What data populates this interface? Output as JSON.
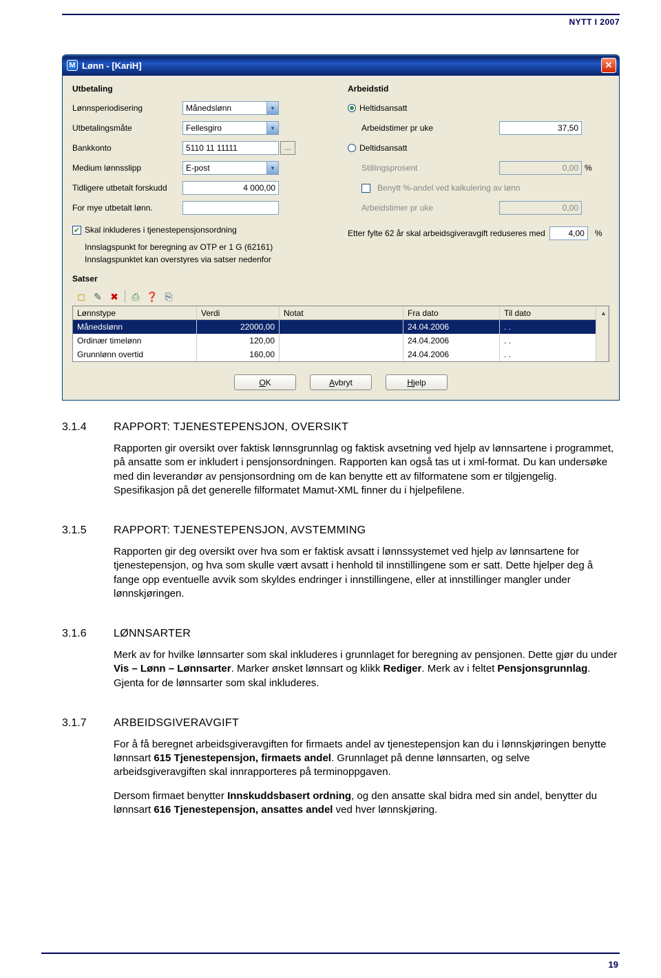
{
  "header": {
    "right": "NYTT I 2007"
  },
  "app": {
    "title": "Lønn - [KariH]",
    "app_icon_letter": "M",
    "close_icon": "✕",
    "groups": {
      "utbetaling": {
        "title": "Utbetaling",
        "rows": {
          "periodisering": {
            "label": "Lønnsperiodisering",
            "value": "Månedslønn"
          },
          "utbetalingsmate": {
            "label": "Utbetalingsmåte",
            "value": "Fellesgiro"
          },
          "bankkonto": {
            "label": "Bankkonto",
            "value": "5110 11 11111"
          },
          "medium": {
            "label": "Medium lønnsslipp",
            "value": "E-post"
          },
          "tidligere": {
            "label": "Tidligere utbetalt forskudd",
            "value": "4 000,00"
          },
          "formye": {
            "label": "For mye utbetalt lønn.",
            "value": ""
          }
        },
        "pension_check": {
          "checked": true,
          "label": "Skal inkluderes i tjenestepensjonsordning"
        },
        "otp_line": "Innslagspunkt for beregning av OTP er 1 G (62161)",
        "overstyr_line": "Innslagspunktet kan overstyres via satser nedenfor"
      },
      "arbeidstid": {
        "title": "Arbeidstid",
        "heltid": {
          "label": "Heltidsansatt",
          "checked": true
        },
        "deltid": {
          "label": "Deltidsansatt",
          "checked": false
        },
        "arbeidstimer1": {
          "label": "Arbeidstimer pr uke",
          "value": "37,50"
        },
        "stillingsprosent": {
          "label": "Stillingsprosent",
          "value": "0,00",
          "pct": "%"
        },
        "benytt": {
          "label": "Benytt %-andel ved kalkulering av lønn",
          "checked": false
        },
        "arbeidstimer2": {
          "label": "Arbeidstimer pr uke",
          "value": "0,00"
        },
        "etter62": {
          "label": "Etter fylte 62 år skal arbeidsgiveravgift reduseres med",
          "value": "4,00",
          "pct": "%"
        }
      }
    },
    "satser": {
      "title": "Satser",
      "headers": {
        "type": "Lønnstype",
        "val": "Verdi",
        "note": "Notat",
        "from": "Fra dato",
        "to": "Til dato"
      },
      "rows": [
        {
          "type": "Månedslønn",
          "val": "22000,00",
          "note": "",
          "from": "24.04.2006",
          "to": ". .",
          "selected": true
        },
        {
          "type": "Ordinær timelønn",
          "val": "120,00",
          "note": "",
          "from": "24.04.2006",
          "to": ". .",
          "selected": false
        },
        {
          "type": "Grunnlønn overtid",
          "val": "160,00",
          "note": "",
          "from": "24.04.2006",
          "to": ". .",
          "selected": false
        }
      ]
    },
    "buttons": {
      "ok": {
        "u": "O",
        "rest": "K"
      },
      "avbryt": {
        "u": "A",
        "rest": "vbryt"
      },
      "hjelp": {
        "u": "H",
        "rest": "jelp"
      }
    }
  },
  "sections": {
    "s314": {
      "num": "3.1.4",
      "title": "RAPPORT: TJENESTEPENSJON, OVERSIKT",
      "p1": "Rapporten gir oversikt over faktisk lønnsgrunnlag og faktisk avsetning ved hjelp av lønnsartene i programmet, på ansatte som er inkludert i pensjonsordningen. Rapporten kan også tas ut i xml-format. Du kan undersøke med din leverandør av pensjonsordning om de kan benytte ett av filformatene som er tilgjengelig. Spesifikasjon på det generelle filformatet Mamut-XML finner du i hjelpefilene."
    },
    "s315": {
      "num": "3.1.5",
      "title": "RAPPORT: TJENESTEPENSJON, AVSTEMMING",
      "p1": "Rapporten gir deg oversikt over hva som er faktisk avsatt i lønnssystemet ved hjelp av lønnsartene for tjenestepensjon, og hva som skulle vært avsatt i henhold til innstillingene som er satt. Dette hjelper deg å fange opp eventuelle avvik som skyldes endringer i innstillingene, eller at innstillinger mangler under lønnskjøringen."
    },
    "s316": {
      "num": "3.1.6",
      "title": "LØNNSARTER",
      "p1_pre": "Merk av for hvilke lønnsarter som skal inkluderes i grunnlaget for beregning av pensjonen. Dette gjør du under ",
      "p1_b1": "Vis – Lønn – Lønnsarter",
      "p1_mid": ". Marker ønsket lønnsart og klikk ",
      "p1_b2": "Rediger",
      "p1_mid2": ". Merk av i feltet ",
      "p1_b3": "Pensjonsgrunnlag",
      "p1_post": ". Gjenta for de lønnsarter som skal inkluderes."
    },
    "s317": {
      "num": "3.1.7",
      "title": "ARBEIDSGIVERAVGIFT",
      "p1_pre": "For å få beregnet arbeidsgiveravgiften for firmaets andel av tjenestepensjon kan du i lønnskjøringen benytte lønnsart ",
      "p1_b1": "615 Tjenestepensjon, firmaets andel",
      "p1_post": ". Grunnlaget på denne lønnsarten, og selve arbeidsgiveravgiften skal innrapporteres på terminoppgaven.",
      "p2_pre": "Dersom firmaet benytter ",
      "p2_b1": "Innskuddsbasert ordning",
      "p2_mid": ", og den ansatte skal bidra med sin andel, benytter du lønnsart ",
      "p2_b2": "616 Tjenestepensjon, ansattes andel",
      "p2_post": " ved hver lønnskjøring."
    }
  },
  "page_number": "19"
}
